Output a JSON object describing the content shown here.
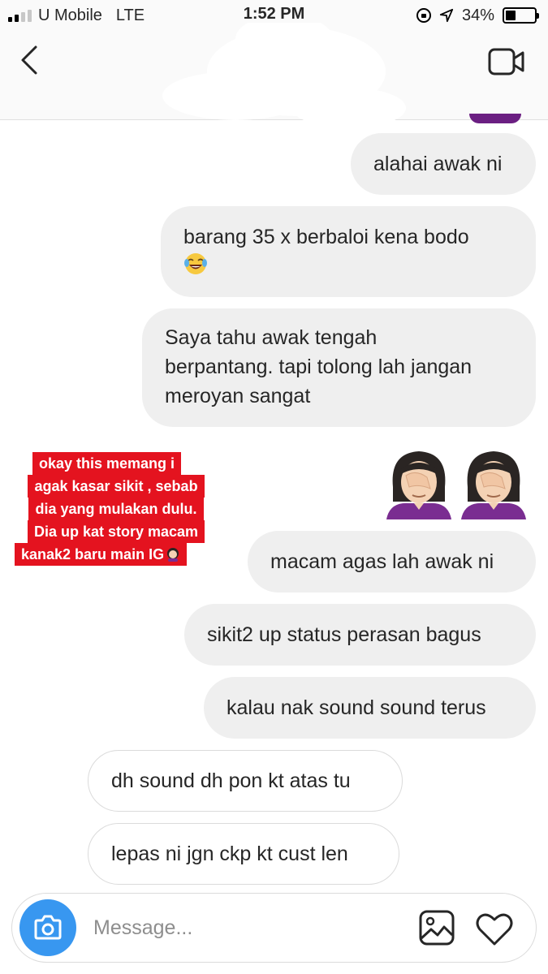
{
  "status_bar": {
    "carrier": "U Mobile",
    "network": "LTE",
    "time": "1:52 PM",
    "battery": "34%",
    "battery_level": 0.34,
    "signal_bars_active": 2,
    "signal_bars_total": 4
  },
  "header": {
    "back_icon": "chevron-left-icon",
    "video_call_icon": "video-camera-icon"
  },
  "messages": [
    {
      "direction": "sent",
      "text": "alahai awak ni"
    },
    {
      "direction": "sent",
      "line1": "barang 35  x berbaloi kena bodo",
      "emoji": "face-with-tears-of-joy"
    },
    {
      "direction": "sent",
      "lines": [
        "Saya tahu awak tengah",
        "berpantang. tapi tolong lah jangan",
        "meroyan sangat"
      ]
    },
    {
      "direction": "sent",
      "type": "emoji",
      "emoji": "woman-facepalming",
      "count": 2
    },
    {
      "direction": "sent",
      "text": "macam agas lah awak ni"
    },
    {
      "direction": "sent",
      "text": "sikit2 up status perasan bagus"
    },
    {
      "direction": "sent",
      "text": "kalau nak sound sound terus"
    },
    {
      "direction": "received",
      "text": "dh sound dh pon kt atas tu"
    },
    {
      "direction": "received",
      "text": "lepas ni jgn ckp kt cust len"
    }
  ],
  "annotation": {
    "lines": [
      "okay this memang i",
      "agak kasar sikit , sebab",
      "dia yang mulakan dulu.",
      "Dia up kat story macam",
      "kanak2 baru main IG"
    ],
    "color": "#e4131f"
  },
  "composer": {
    "placeholder": "Message...",
    "camera_icon": "camera-icon",
    "gallery_icon": "image-gallery-icon",
    "like_icon": "heart-icon"
  },
  "colors": {
    "accent": "#3897f0",
    "sent_bubble": "#efefef",
    "received_border": "#dbdbdb"
  }
}
